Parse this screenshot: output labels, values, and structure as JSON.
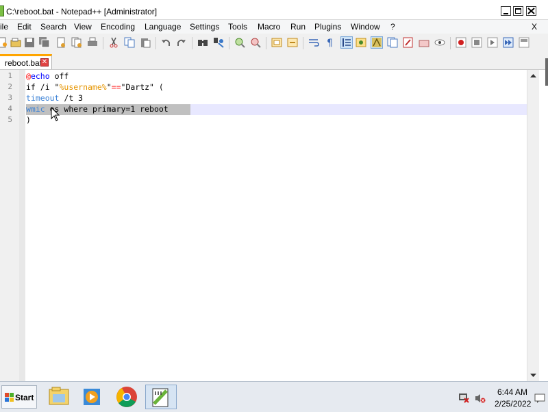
{
  "window": {
    "title": "C:\\reboot.bat - Notepad++ [Administrator]",
    "menu_close_glyph": "X"
  },
  "menu": [
    {
      "label": "ile"
    },
    {
      "label": "Edit"
    },
    {
      "label": "Search"
    },
    {
      "label": "View"
    },
    {
      "label": "Encoding"
    },
    {
      "label": "Language"
    },
    {
      "label": "Settings"
    },
    {
      "label": "Tools"
    },
    {
      "label": "Macro"
    },
    {
      "label": "Run"
    },
    {
      "label": "Plugins"
    },
    {
      "label": "Window"
    },
    {
      "label": "?"
    }
  ],
  "toolbar_icons": [
    "new-file-icon",
    "open-file-icon",
    "save-icon",
    "save-all-icon",
    "close-file-icon",
    "close-all-icon",
    "print-icon",
    "cut-icon",
    "copy-icon",
    "paste-icon",
    "undo-icon",
    "redo-icon",
    "find-icon",
    "replace-icon",
    "zoom-in-icon",
    "zoom-out-icon",
    "sync-vertical-icon",
    "sync-horizontal-icon",
    "word-wrap-icon",
    "show-all-chars-icon",
    "indent-guide-icon",
    "user-lang-icon",
    "doc-map-icon",
    "function-list-icon",
    "folder-workspace-icon",
    "monitoring-icon",
    "record-macro-icon",
    "stop-record-icon",
    "play-macro-icon",
    "run-macro-multiple-icon",
    "save-macro-icon"
  ],
  "tab": {
    "label": "reboot.bat",
    "close_glyph": "✕"
  },
  "editor": {
    "line_numbers": [
      "1",
      "2",
      "3",
      "4",
      "5"
    ],
    "lines": [
      [
        {
          "t": "@",
          "c": "at"
        },
        {
          "t": "echo",
          "c": "kw"
        },
        {
          "t": " off",
          "c": "plain"
        }
      ],
      [
        {
          "t": "if /i \"",
          "c": "plain"
        },
        {
          "t": "%username%",
          "c": "var"
        },
        {
          "t": "\"",
          "c": "plain"
        },
        {
          "t": "==",
          "c": "op"
        },
        {
          "t": "\"Dartz\" (",
          "c": "plain"
        }
      ],
      [
        {
          "t": "timeout",
          "c": "kw2"
        },
        {
          "t": " /t 3",
          "c": "plain"
        }
      ],
      [
        {
          "t": "wmic",
          "c": "kw2"
        },
        {
          "t": " os where primary=1 reboot",
          "c": "plain"
        }
      ],
      [
        {
          "t": ")",
          "c": "plain"
        }
      ]
    ]
  },
  "taskbar": {
    "start_label": "Start",
    "apps": [
      "file-explorer-icon",
      "media-player-icon",
      "chrome-icon",
      "notepadpp-icon"
    ],
    "clock_time": "6:44 AM",
    "clock_date": "2/25/2022",
    "tray_icons": [
      "network-disconnected-icon",
      "volume-muted-icon",
      "action-center-icon"
    ]
  },
  "colors": {
    "keyword": "#0000ff",
    "command": "#3c82d6",
    "variable": "#e69500",
    "operator": "#ff0000",
    "tab_accent": "#ffa500",
    "current_line": "#e8e8ff"
  }
}
